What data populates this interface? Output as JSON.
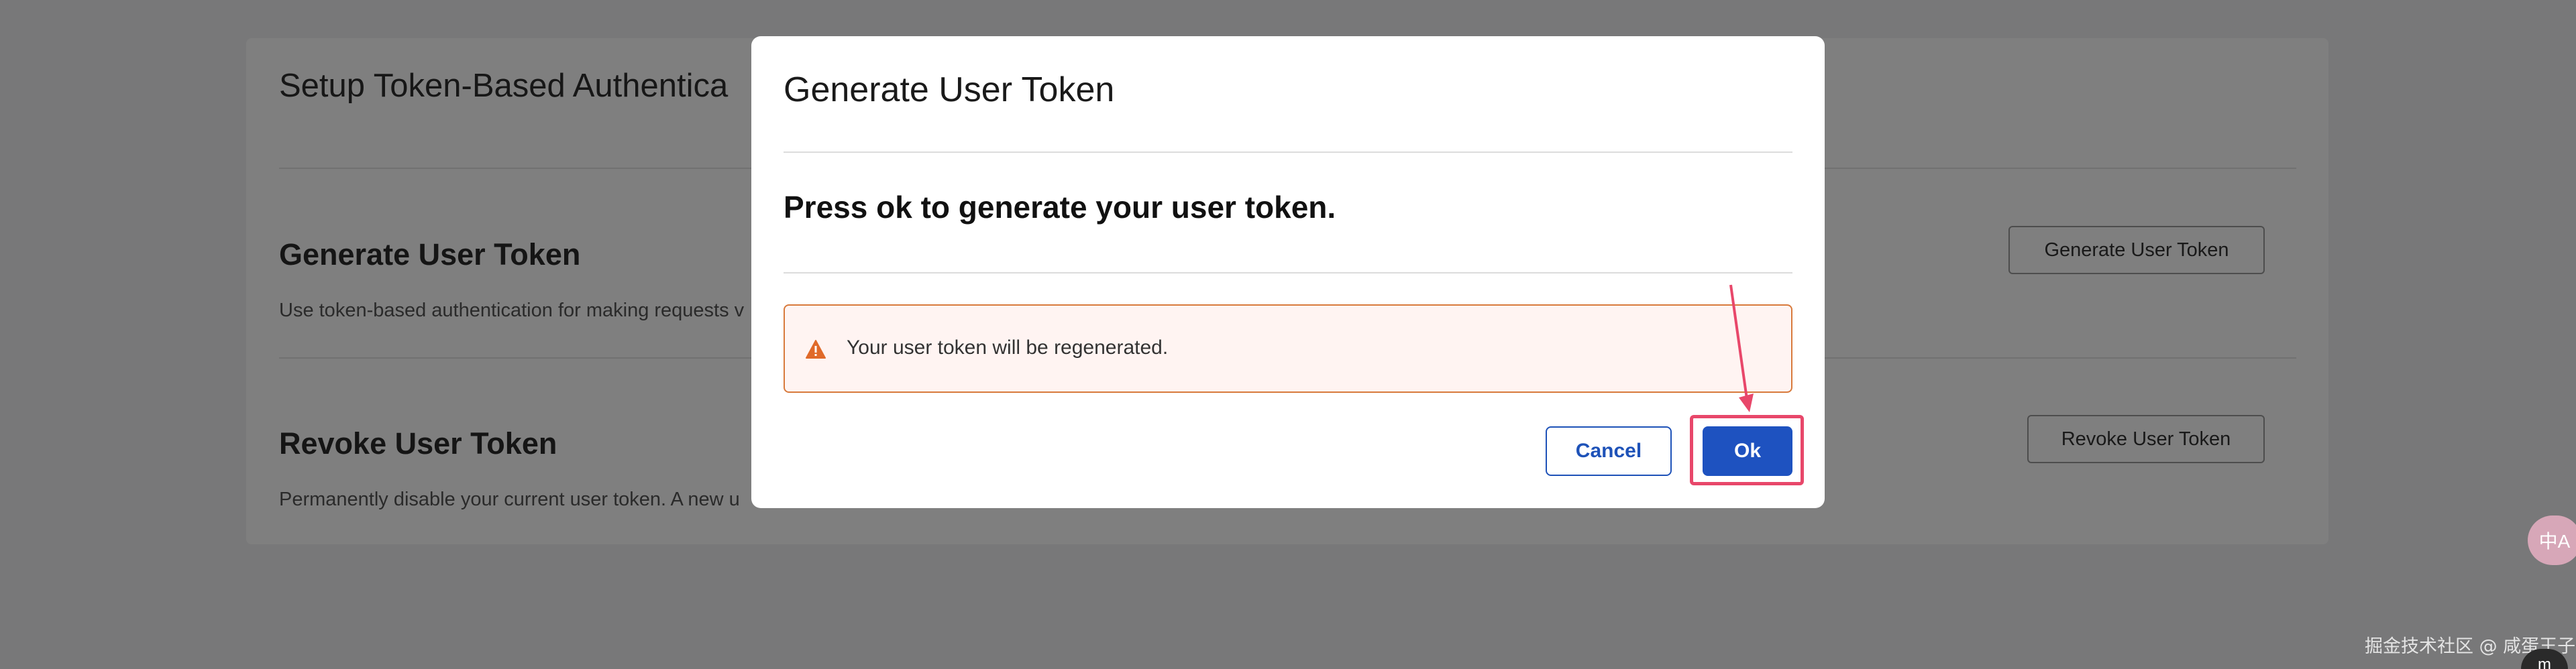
{
  "background": {
    "title": "Setup Token-Based Authentica",
    "sections": [
      {
        "title": "Generate User Token",
        "description": "Use token-based authentication for making requests v",
        "button_label": "Generate User Token"
      },
      {
        "title": "Revoke User Token",
        "description": "Permanently disable your current user token. A new u",
        "button_label": "Revoke User Token"
      }
    ]
  },
  "modal": {
    "title": "Generate User Token",
    "message": "Press ok to generate your user token.",
    "warning": {
      "icon": "warning-triangle-icon",
      "text": "Your user token will be regenerated."
    },
    "cancel_label": "Cancel",
    "ok_label": "Ok"
  },
  "annotation": {
    "highlight_color": "#e8476a"
  },
  "floating": {
    "translate_label": "中A",
    "watermark": "掘金技术社区 @ 咸蛋王子",
    "badge_label": "m"
  },
  "colors": {
    "primary": "#1e52c0",
    "warning_border": "#d87a3c",
    "warning_bg": "#fff4f2",
    "warning_icon": "#e06a2a"
  }
}
